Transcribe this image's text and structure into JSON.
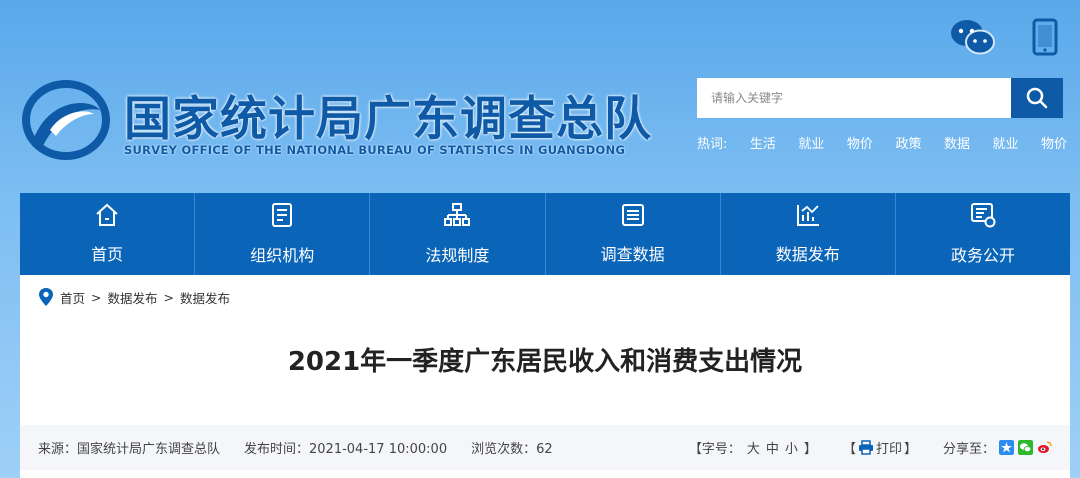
{
  "header": {
    "title": "国家统计局广东调查总队",
    "subtitle": "SURVEY OFFICE OF THE NATIONAL BUREAU OF STATISTICS IN GUANGDONG",
    "icons": [
      "wechat-icon",
      "mobile-icon"
    ]
  },
  "search": {
    "placeholder": "请输入关键字",
    "hot_label": "热词:",
    "hot_words": [
      "生活",
      "就业",
      "物价",
      "政策",
      "数据",
      "就业",
      "物价"
    ]
  },
  "nav": {
    "items": [
      {
        "label": "首页",
        "icon": "home-icon"
      },
      {
        "label": "组织机构",
        "icon": "document-icon"
      },
      {
        "label": "法规制度",
        "icon": "org-chart-icon"
      },
      {
        "label": "调查数据",
        "icon": "list-icon"
      },
      {
        "label": "数据发布",
        "icon": "chart-icon"
      },
      {
        "label": "政务公开",
        "icon": "monitor-icon"
      }
    ]
  },
  "breadcrumb": {
    "items": [
      "首页",
      "数据发布",
      "数据发布"
    ],
    "separator": ">"
  },
  "article": {
    "title": "2021年一季度广东居民收入和消费支出情况",
    "source": "来源：国家统计局广东调查总队",
    "publish_time": "发布时间：2021-04-17 10:00:00",
    "views": "浏览次数：62",
    "font_size_label": "【字号：",
    "font_large": "大",
    "font_medium": "中",
    "font_small": "小",
    "font_size_end": "】",
    "print_open": "【",
    "print_label": "打印",
    "print_close": "】",
    "share_label": "分享至："
  },
  "colors": {
    "brand_blue": "#0f5aa6",
    "nav_blue": "#0a64b8",
    "share_blue": "#2d8cf0",
    "share_green": "#2eb82e",
    "share_red": "#e6162d"
  }
}
